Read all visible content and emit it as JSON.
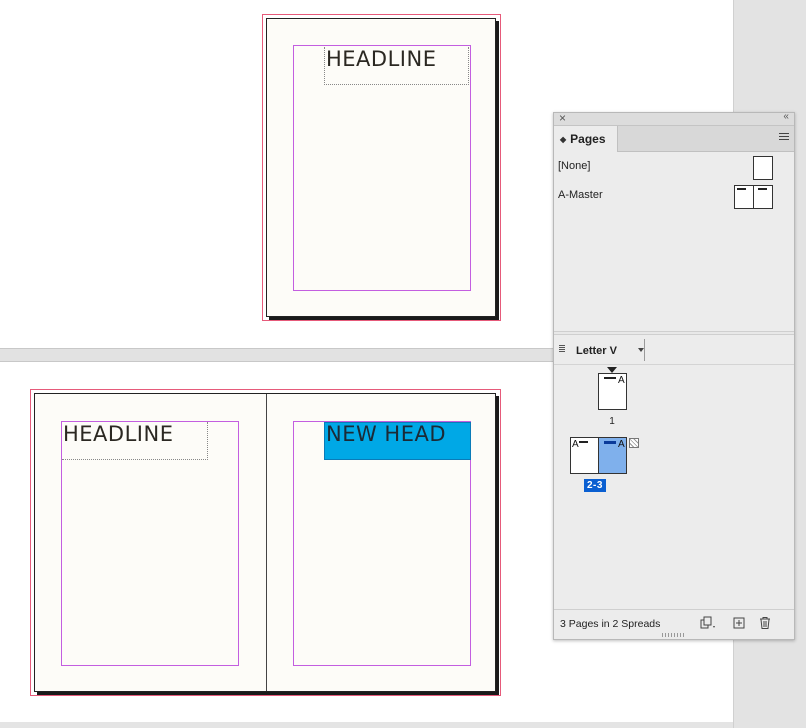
{
  "document": {
    "top_page": {
      "headline": "HEADLINE"
    },
    "spread": {
      "left_page": {
        "headline": "HEADLINE"
      },
      "right_page": {
        "headline": "NEW HEAD"
      }
    }
  },
  "pages_panel": {
    "close_icon": "close-icon",
    "collapse_icon": "double-chevron-left-icon",
    "tab_label": "Pages",
    "menu_icon": "hamburger-menu-icon",
    "masters": [
      {
        "label": "[None]"
      },
      {
        "label": "A-Master"
      }
    ],
    "page_size": "Letter V",
    "pages": [
      {
        "number": "1",
        "master_prefix": "A"
      },
      {
        "number": "2-3",
        "left_prefix": "A",
        "right_prefix": "A"
      }
    ],
    "status": "3 Pages in 2 Spreads",
    "footer_icons": [
      "edit-page-size-icon",
      "new-page-icon",
      "trash-icon"
    ],
    "colors": {
      "selection": "#0a5fd1",
      "selected_page": "#7fb0ec",
      "frame_highlight": "#00a8e6",
      "margin_guide": "#c35ee0",
      "bleed_guide": "#e65a7a"
    }
  }
}
